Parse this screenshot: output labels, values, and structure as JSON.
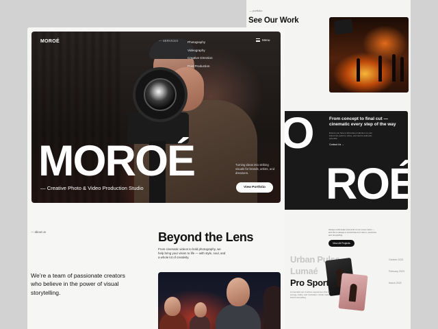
{
  "back_page": {
    "crumb": "— portfolio",
    "heading": "See Our Work",
    "big_word_1": "IO",
    "big_word_2": "ROÉ",
    "tagline": "From concept to final cut — cinematic every step of the way",
    "tagline_desc": "Ensure you have a full-scale production so your brand can perform, shine, and feel its authentic potential.",
    "tagline_link": "Contact Us  →",
    "projects_text": "Always a full-scale crew kind of our recent team — and this is always a crucial blend of vision, execution, and storytelling.",
    "view_all_label": "View All Projects",
    "projects": [
      {
        "name": "Urban Pulse",
        "date": "October 2023"
      },
      {
        "name": "Lumaé",
        "date": "February 2023"
      },
      {
        "name": "Pro Sport",
        "date": "March 2023"
      }
    ],
    "project_desc": "A cinematic set of action sequences shot for energy, rivalry, and motivation. Under vision, brand storytelling."
  },
  "nav": {
    "logo": "MOROÉ",
    "services_label": "— SERVICES",
    "services": [
      "Photography",
      "Videography",
      "Creative Direction",
      "Post Production"
    ],
    "menu_label": "Menu"
  },
  "hero": {
    "title": "MOROÉ",
    "subtitle": "— Creative Photo & Video Production Studio",
    "side_text": "Turning ideas into striking visuals for brands, artists, and dreamers.",
    "cta_label": "View Portfolio"
  },
  "about": {
    "label": "— about us",
    "text": "We’re a team of passionate creators who believe in the power of visual storytelling.",
    "title": "Beyond the Lens",
    "description": "From cinematic videos to bold photography, we help bring your vision to life — with style, soul, and a whole lot of creativity."
  }
}
